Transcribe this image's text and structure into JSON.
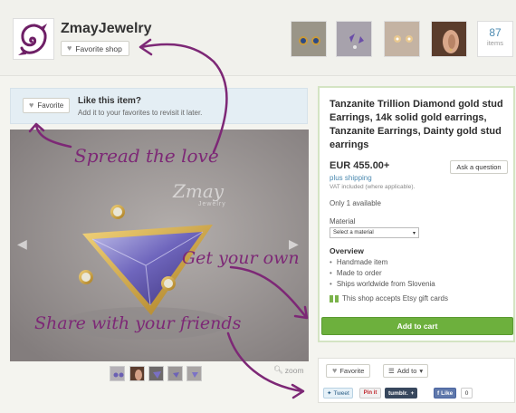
{
  "shop": {
    "name": "ZmayJewelry",
    "favorite_label": "Favorite shop",
    "items_count": "87",
    "items_label": "items"
  },
  "favorite_banner": {
    "button_label": "Favorite",
    "title": "Like this item?",
    "subtitle": "Add it to your favorites to revisit it later."
  },
  "image": {
    "watermark": "Zmay",
    "watermark_sub": "Jewelry",
    "zoom_label": "zoom"
  },
  "listing": {
    "title": "Tanzanite Trillion Diamond gold stud Earrings, 14k solid gold earrings, Tanzanite Earrings, Dainty gold stud earrings",
    "price": "EUR 455.00+",
    "shipping": "plus shipping",
    "vat_note": "VAT included (where applicable).",
    "ask_label": "Ask a question",
    "availability": "Only 1 available",
    "material_label": "Material",
    "material_select": "Select a material",
    "overview_title": "Overview",
    "overview_items": [
      "Handmade item",
      "Made to order",
      "Ships worldwide from Slovenia"
    ],
    "gift_text": "This shop accepts Etsy gift cards",
    "cart_label": "Add to cart"
  },
  "social": {
    "favorite_label": "Favorite",
    "add_to_label": "Add to",
    "tweet_label": "Tweet",
    "pinit_label": "Pin it",
    "tumblr_label": "tumblr.",
    "fb_label": "Like",
    "fb_count": "0"
  },
  "annotations": {
    "spread": "Spread the love",
    "get": "Get your own",
    "share": "Share with your friends"
  },
  "colors": {
    "annotation": "#7d2876",
    "cart_green": "#6db03d",
    "link_blue": "#4c8ab0"
  }
}
